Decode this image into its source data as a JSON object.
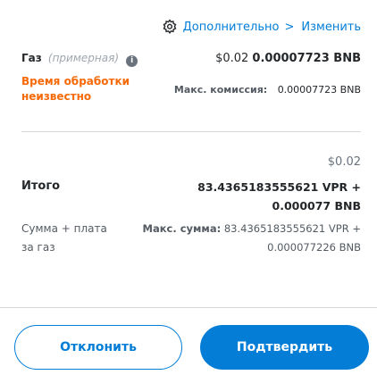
{
  "header": {
    "advanced_label": "Дополнительно",
    "chevron": ">",
    "edit_label": "Изменить"
  },
  "gas": {
    "label": "Газ",
    "estimated_label": "(примерная)",
    "info_symbol": "i",
    "fiat": "$0.02",
    "amount": "0.00007723 BNB",
    "time_unknown": "Время обработки неизвестно",
    "max_fee_label": "Макс. комиссия:",
    "max_fee_value": "0.00007723 BNB"
  },
  "total": {
    "fiat": "$0.02",
    "label": "Итого",
    "value": "83.4365183555621 VPR + 0.000077 BNB",
    "sum_label": "Сумма + плата за газ",
    "max_sum_label": "Макс. сумма:",
    "max_sum_value": "83.4365183555621 VPR + 0.000077226 BNB"
  },
  "actions": {
    "reject_label": "Отклонить",
    "confirm_label": "Подтвердить"
  },
  "colors": {
    "accent": "#037dd6",
    "warning": "#f66a0a",
    "muted": "#6a737d"
  }
}
